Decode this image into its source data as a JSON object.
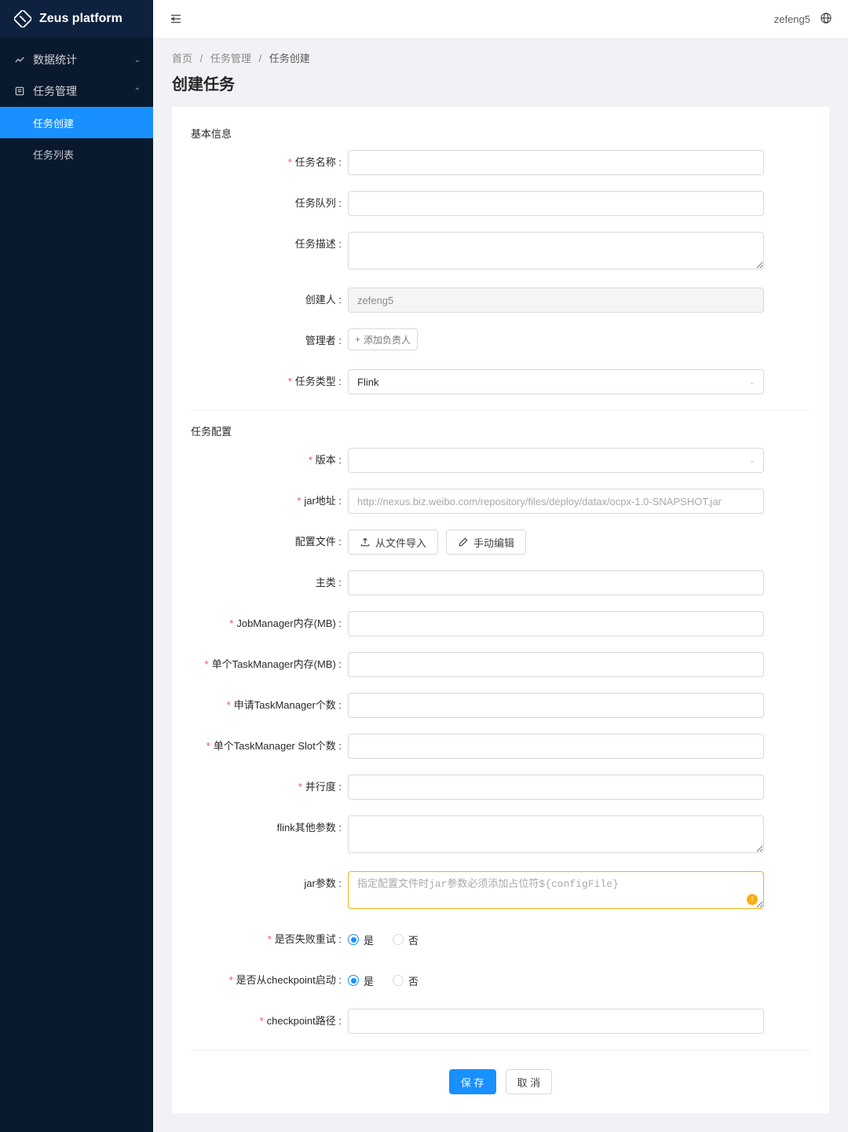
{
  "brand": {
    "title": "Zeus platform"
  },
  "topbar": {
    "username": "zefeng5"
  },
  "sidebar": {
    "menu1": {
      "label": "数据统计"
    },
    "menu2": {
      "label": "任务管理",
      "children": [
        {
          "label": "任务创建"
        },
        {
          "label": "任务列表"
        }
      ]
    }
  },
  "breadcrumb": {
    "home": "首页",
    "parent": "任务管理",
    "current": "任务创建"
  },
  "page_title": "创建任务",
  "section_basic": "基本信息",
  "section_config": "任务配置",
  "labels": {
    "task_name": "任务名称 :",
    "task_queue": "任务队列 :",
    "task_desc": "任务描述 :",
    "creator": "创建人 :",
    "manager": "管理者 :",
    "task_type": "任务类型 :",
    "version": "版本 :",
    "jar_url": "jar地址 :",
    "config_file": "配置文件 :",
    "main_class": "主类 :",
    "jm_mem": "JobManager内存(MB) :",
    "tm_mem": "单个TaskManager内存(MB) :",
    "tm_count": "申请TaskManager个数 :",
    "tm_slots": "单个TaskManager Slot个数 :",
    "parallelism": "并行度 :",
    "flink_other": "flink其他参数 :",
    "jar_params": "jar参数 :",
    "retry": "是否失败重试 :",
    "from_checkpoint": "是否从checkpoint启动 :",
    "checkpoint_path": "checkpoint路径 :"
  },
  "values": {
    "creator": "zefeng5",
    "task_type": "Flink",
    "jar_url_placeholder": "http://nexus.biz.weibo.com/repository/files/deploy/datax/ocpx-1.0-SNAPSHOT.jar",
    "jar_params_placeholder": "指定配置文件时jar参数必须添加占位符${configFile}"
  },
  "buttons": {
    "add_manager": "添加负责人",
    "import_file": "从文件导入",
    "manual_edit": "手动编辑",
    "save": "保 存",
    "cancel": "取 消"
  },
  "radio": {
    "yes": "是",
    "no": "否"
  }
}
